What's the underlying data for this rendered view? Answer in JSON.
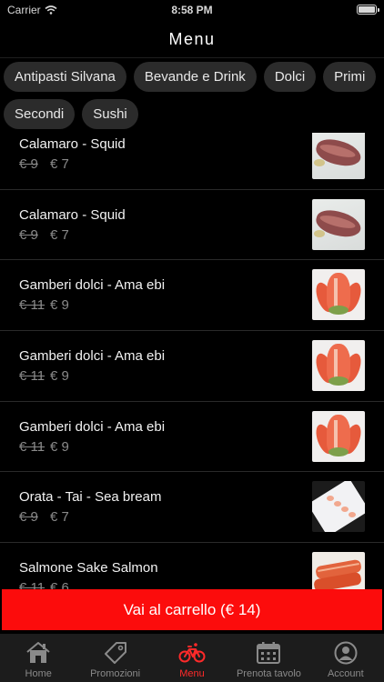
{
  "status_bar": {
    "carrier": "Carrier",
    "time": "8:58 PM"
  },
  "header": {
    "title": "Menu"
  },
  "categories": [
    {
      "label": "Antipasti Silvana"
    },
    {
      "label": "Bevande e Drink"
    },
    {
      "label": "Dolci"
    },
    {
      "label": "Primi"
    },
    {
      "label": "Secondi"
    },
    {
      "label": "Sushi"
    }
  ],
  "items": [
    {
      "name": "Calamaro - Squid",
      "old_price": "€ 9",
      "price": "€ 7",
      "image": "squid"
    },
    {
      "name": "Calamaro - Squid",
      "old_price": "€ 9",
      "price": "€ 7",
      "image": "squid"
    },
    {
      "name": "Gamberi dolci - Ama ebi",
      "old_price": "€ 11",
      "price": "€ 9",
      "image": "ebi"
    },
    {
      "name": "Gamberi dolci - Ama ebi",
      "old_price": "€ 11",
      "price": "€ 9",
      "image": "ebi"
    },
    {
      "name": "Gamberi dolci - Ama ebi",
      "old_price": "€ 11",
      "price": "€ 9",
      "image": "ebi"
    },
    {
      "name": "Orata - Tai - Sea bream",
      "old_price": "€ 9",
      "price": "€ 7",
      "image": "tai"
    },
    {
      "name": "Salmone Sake Salmon",
      "old_price": "€ 11",
      "price": "€ 6",
      "image": "salmon"
    }
  ],
  "cart_button": {
    "label": "Vai al carrello (€ 14)"
  },
  "tabs": [
    {
      "label": "Home",
      "icon": "home-icon"
    },
    {
      "label": "Promozioni",
      "icon": "tag-icon"
    },
    {
      "label": "Menu",
      "icon": "bicycle-icon"
    },
    {
      "label": "Prenota tavolo",
      "icon": "calendar-icon"
    },
    {
      "label": "Account",
      "icon": "account-icon"
    }
  ],
  "colors": {
    "accent": "#fc0c0c",
    "active_tab": "#ff2a2a",
    "chip_bg": "#2b2b2b",
    "tab_bar_bg": "#1c1c1c"
  }
}
